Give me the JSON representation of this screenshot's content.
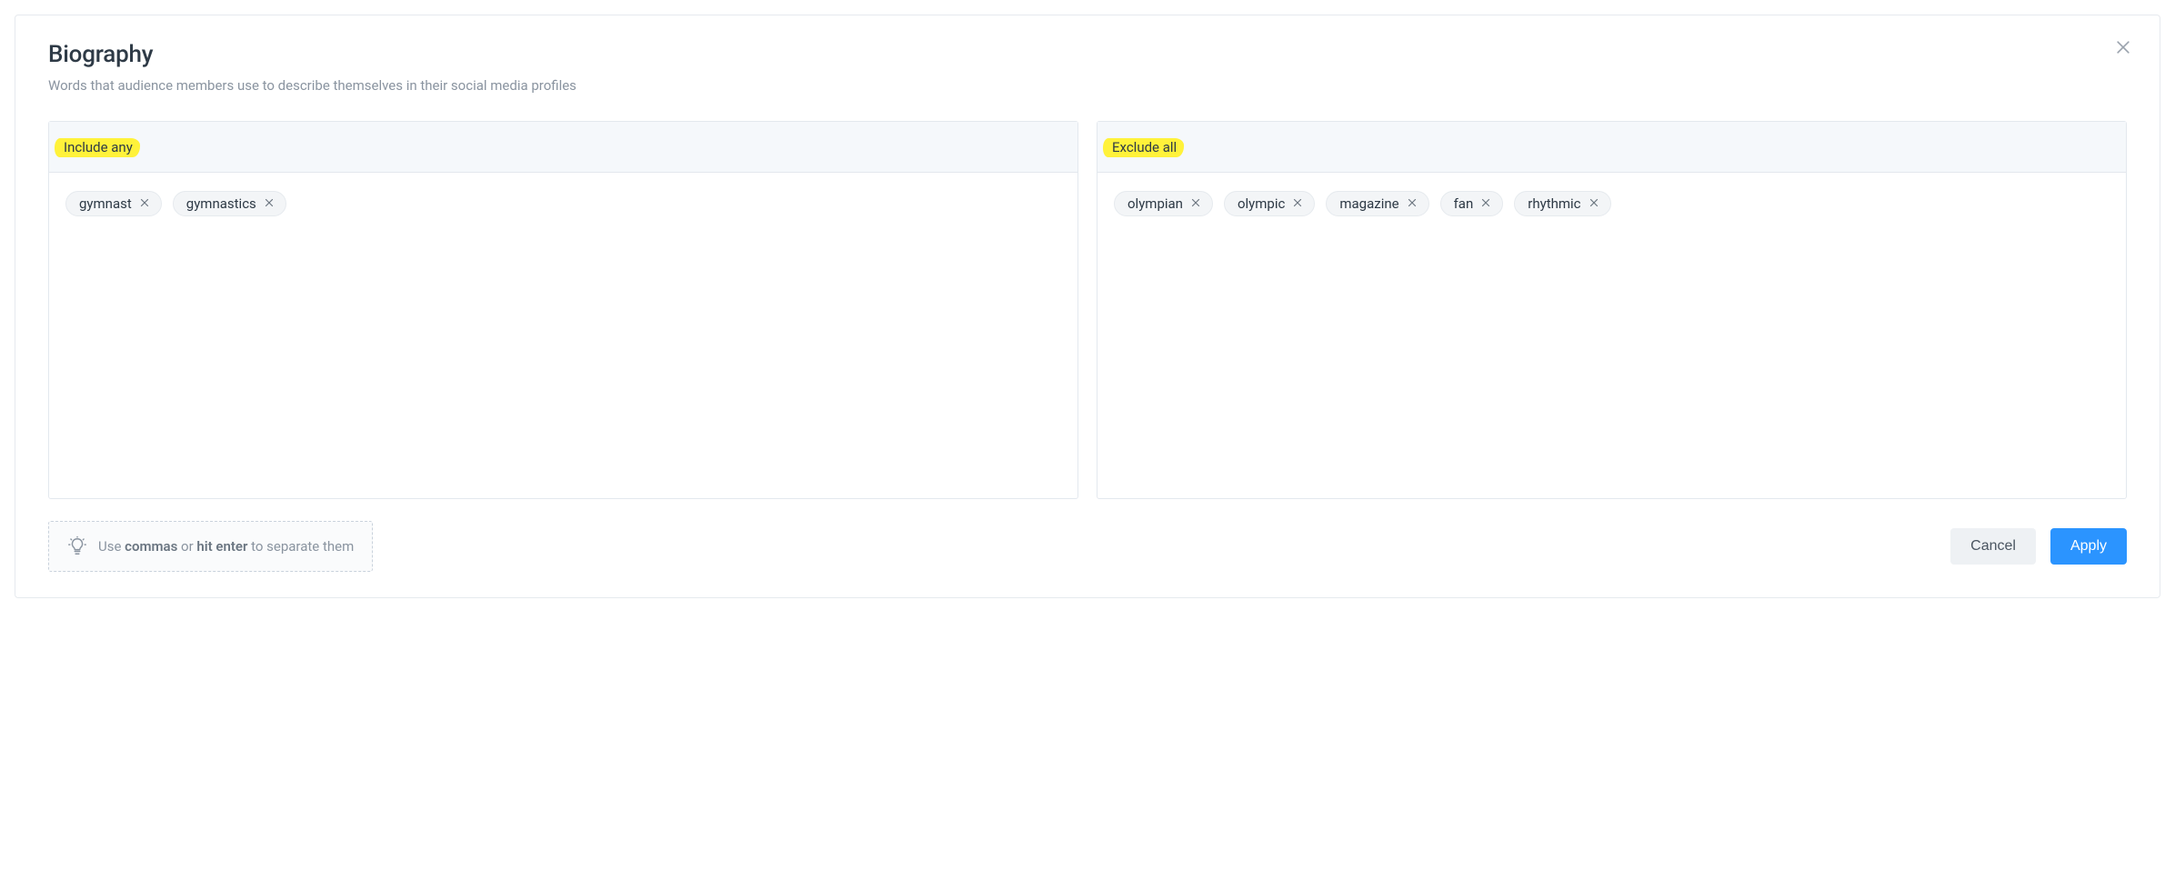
{
  "title": "Biography",
  "subtitle": "Words that audience members use to describe themselves in their social media profiles",
  "panels": {
    "include": {
      "label": "Include any",
      "tags": [
        "gymnast",
        "gymnastics"
      ]
    },
    "exclude": {
      "label": "Exclude all",
      "tags": [
        "olympian",
        "olympic",
        "magazine",
        "fan",
        "rhythmic"
      ]
    }
  },
  "hint": {
    "prefix": "Use ",
    "strong1": "commas",
    "mid": " or ",
    "strong2": "hit enter",
    "suffix": " to separate them"
  },
  "buttons": {
    "cancel": "Cancel",
    "apply": "Apply"
  }
}
